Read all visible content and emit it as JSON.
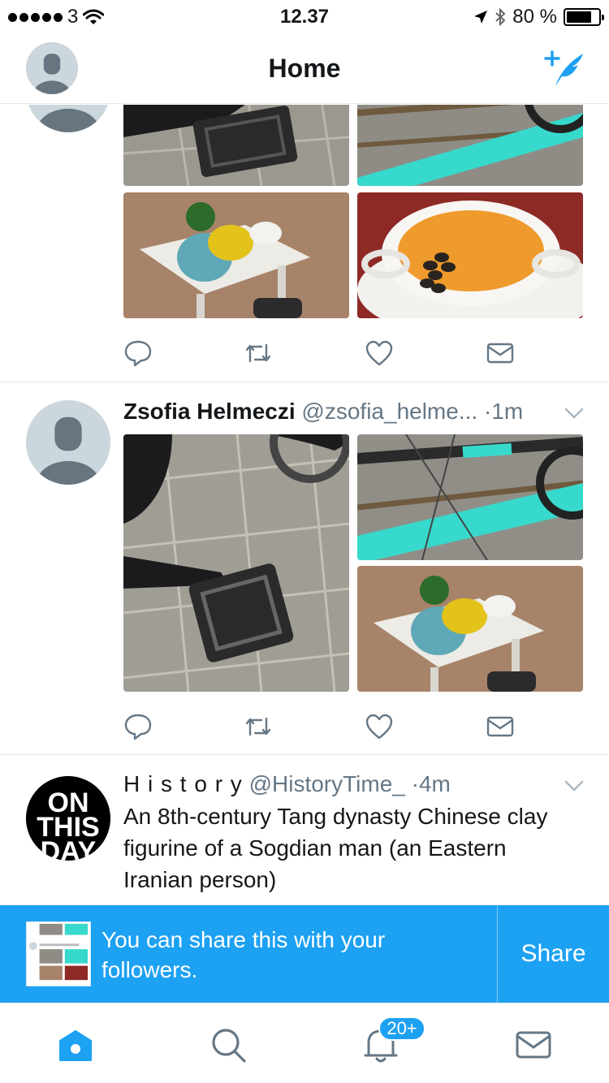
{
  "status_bar": {
    "carrier": "3",
    "time": "12.37",
    "battery": "80 %",
    "battery_level": 0.8
  },
  "navbar": {
    "title": "Home",
    "profile_icon": "default-avatar-icon",
    "compose_icon": "compose-tweet-icon"
  },
  "feed": {
    "tweets": [
      {
        "photos": [
          "pedal-photo",
          "chain-photo",
          "table-photo",
          "soup-photo"
        ],
        "actions": [
          "reply-icon",
          "retweet-icon",
          "like-icon",
          "message-icon"
        ]
      },
      {
        "name": "Zsofia Helmeczi",
        "handle": "@zsofia_helme...",
        "separator": "·",
        "time": "1m",
        "photos": [
          "pedal-photo",
          "chain-photo",
          "table-photo"
        ],
        "actions": [
          "reply-icon",
          "retweet-icon",
          "like-icon",
          "message-icon"
        ]
      },
      {
        "name": "H i s t o r y",
        "handle": "@HistoryTime_",
        "separator": "·",
        "time": "4m",
        "avatar_text": [
          "ON",
          "THIS",
          "DAY"
        ],
        "text": "An 8th-century Tang dynasty Chinese clay figurine of a Sogdian man (an Eastern Iranian person)"
      }
    ]
  },
  "share_banner": {
    "message": "You can share this with your followers.",
    "button": "Share"
  },
  "tabbar": {
    "items": [
      "home-icon",
      "search-icon",
      "notifications-icon",
      "messages-icon"
    ],
    "notifications_badge": "20+"
  },
  "colors": {
    "accent": "#1da1f2",
    "text_secondary": "#657786",
    "divider": "#e1e8ed"
  }
}
